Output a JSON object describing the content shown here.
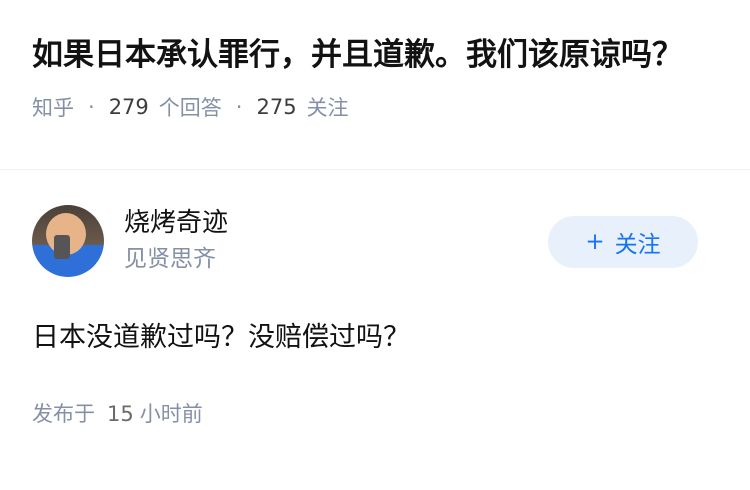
{
  "question": {
    "title": "如果日本承认罪行，并且道歉。我们该原谅吗？",
    "source": "知乎",
    "answers_count": "279",
    "answers_label": "个回答",
    "followers_count": "275",
    "followers_label": "关注",
    "separator": "·"
  },
  "answer": {
    "author": {
      "name": "烧烤奇迹",
      "bio": "见贤思齐",
      "avatar_icon": "user-avatar-photo"
    },
    "follow_button": {
      "plus": "+",
      "label": "关注"
    },
    "content": "日本没道歉过吗？没赔偿过吗？",
    "published_label": "发布于",
    "published_num": "15",
    "published_unit": "小时前"
  },
  "colors": {
    "accent": "#1772f6",
    "follow_bg": "#e8f0fb",
    "muted": "#8590a6"
  }
}
